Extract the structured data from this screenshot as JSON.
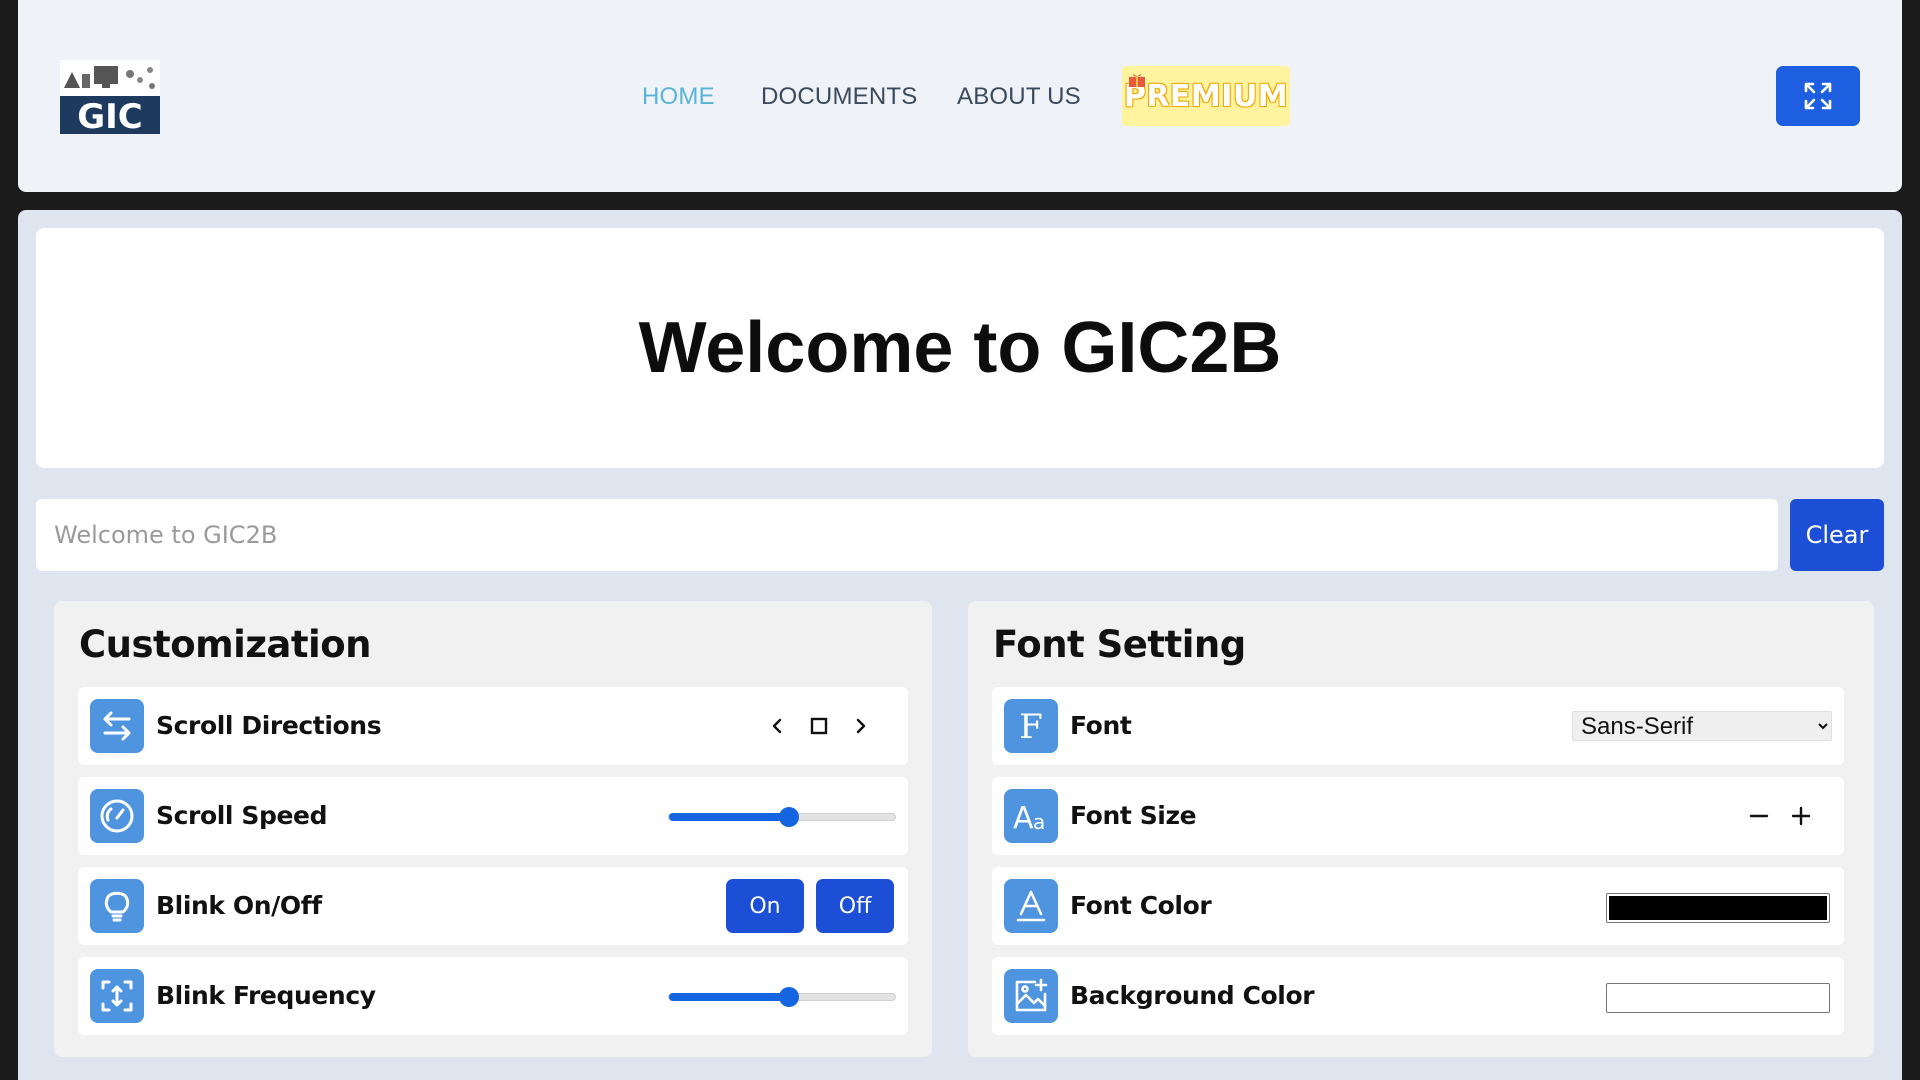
{
  "header": {
    "logo_text": "GIC",
    "nav": [
      {
        "label": "HOME",
        "active": true
      },
      {
        "label": "DOCUMENTS",
        "active": false
      },
      {
        "label": "ABOUT US",
        "active": false
      }
    ],
    "premium_label": "PREMIUM",
    "fullscreen_icon": "expand-icon"
  },
  "main": {
    "welcome_title": "Welcome to GIC2B",
    "input": {
      "placeholder": "Welcome to GIC2B",
      "value": ""
    },
    "clear_label": "Clear"
  },
  "customization": {
    "title": "Customization",
    "scroll_directions": {
      "label": "Scroll Directions",
      "icon": "arrows-left-right-icon"
    },
    "scroll_speed": {
      "label": "Scroll Speed",
      "icon": "speedometer-icon",
      "value_fraction": 0.53
    },
    "blink": {
      "label": "Blink On/Off",
      "icon": "lightbulb-icon",
      "on_label": "On",
      "off_label": "Off"
    },
    "blink_frequency": {
      "label": "Blink Frequency",
      "icon": "frequency-icon",
      "value_fraction": 0.53
    }
  },
  "font_setting": {
    "title": "Font Setting",
    "font": {
      "label": "Font",
      "icon": "font-f-icon",
      "selected": "Sans-Serif"
    },
    "font_size": {
      "label": "Font Size",
      "icon": "text-size-icon"
    },
    "font_color": {
      "label": "Font Color",
      "icon": "font-color-icon",
      "color": "#000000"
    },
    "background_color": {
      "label": "Background Color",
      "icon": "image-add-icon",
      "color": "#ffffff"
    }
  },
  "colors": {
    "accent": "#1d4fd6",
    "icon_bg": "#4f94de",
    "nav_active": "#5ab4d6",
    "premium_bg": "#fff3a0"
  }
}
